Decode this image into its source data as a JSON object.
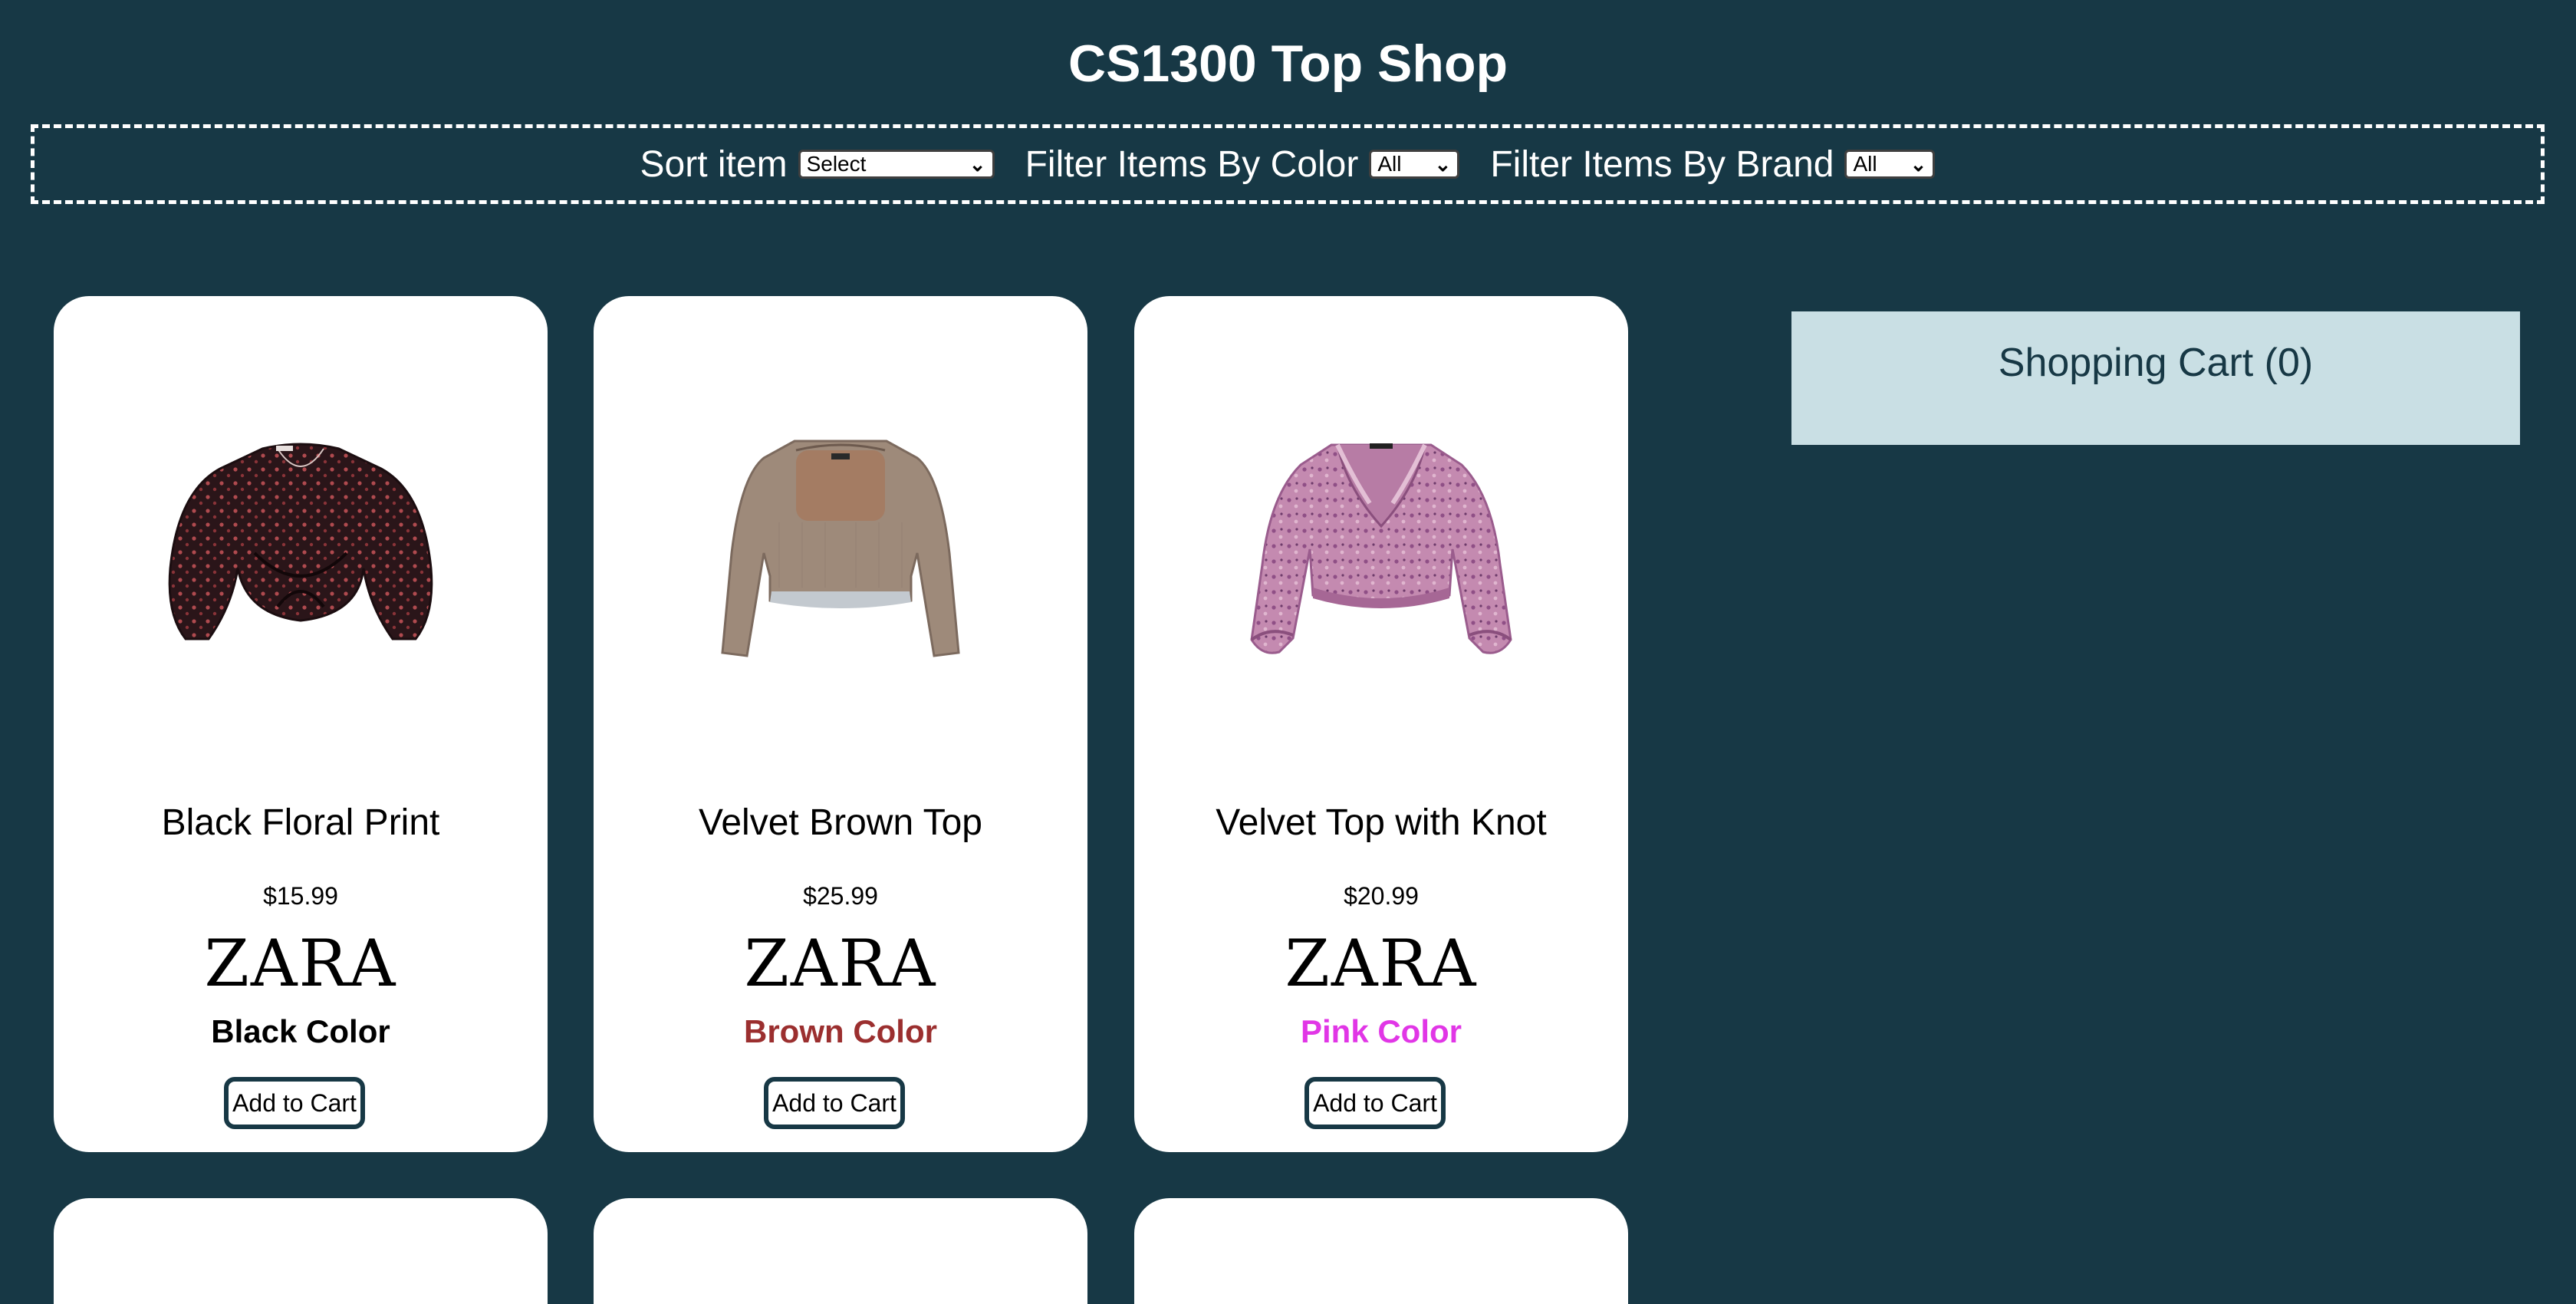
{
  "page": {
    "title": "CS1300 Top Shop"
  },
  "toolbar": {
    "sort_label": "Sort item",
    "sort_value": "Select",
    "color_filter_label": "Filter Items By Color",
    "color_filter_value": "All",
    "brand_filter_label": "Filter Items By Brand",
    "brand_filter_value": "All"
  },
  "products": [
    {
      "name": "Black Floral Print",
      "price": "$15.99",
      "brand": "ZARA",
      "color_label": "Black Color",
      "color_hex": "#000000",
      "add_label": "Add to Cart",
      "image_name": "black-floral-top-image"
    },
    {
      "name": "Velvet Brown Top",
      "price": "$25.99",
      "brand": "ZARA",
      "color_label": "Brown Color",
      "color_hex": "#9b2f2f",
      "add_label": "Add to Cart",
      "image_name": "velvet-brown-top-image"
    },
    {
      "name": "Velvet Top with Knot",
      "price": "$20.99",
      "brand": "ZARA",
      "color_label": "Pink Color",
      "color_hex": "#e136e6",
      "add_label": "Add to Cart",
      "image_name": "velvet-top-with-knot-image"
    }
  ],
  "cart": {
    "title": "Shopping Cart (0)"
  },
  "colors": {
    "background": "#173845",
    "card": "#ffffff",
    "cart_panel": "#c9dfe4"
  }
}
